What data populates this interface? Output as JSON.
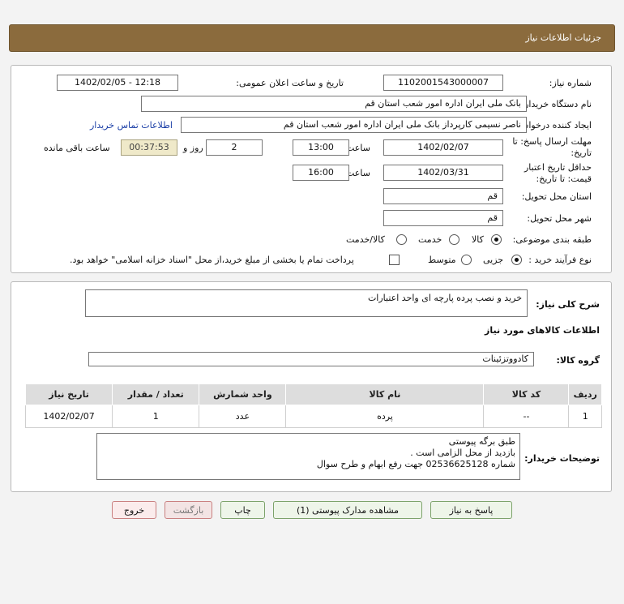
{
  "header": {
    "title": "جزئیات اطلاعات نیاز"
  },
  "form": {
    "need_number_label": "شماره نیاز:",
    "need_number": "1102001543000007",
    "announce_label": "تاریخ و ساعت اعلان عمومی:",
    "announce_value": "1402/02/05 - 12:18",
    "buyer_org_label": "نام دستگاه خریدار:",
    "buyer_org": "بانک ملی ایران اداره امور شعب استان قم",
    "creator_label": "ایجاد کننده درخواست:",
    "creator": "ناصر  نسیمی  کارپرداز  بانک ملی ایران اداره امور شعب استان قم",
    "contact_link": "اطلاعات تماس خریدار",
    "deadline_label_1": "مهلت ارسال پاسخ: تا",
    "deadline_label_2": "تاریخ:",
    "deadline_date": "1402/02/07",
    "time_label": "ساعت",
    "deadline_time": "13:00",
    "days": "2",
    "days_label": "روز و",
    "remaining_time": "00:37:53",
    "remaining_label": "ساعت باقی مانده",
    "validity_label_1": "حداقل تاریخ اعتبار",
    "validity_label_2": "قیمت: تا تاریخ:",
    "validity_date": "1402/03/31",
    "validity_time": "16:00",
    "province_label": "استان محل تحویل:",
    "province": "قم",
    "city_label": "شهر محل تحویل:",
    "city": "قم",
    "category_label": "طبقه بندی موضوعی:",
    "category_options": [
      "کالا",
      "خدمت",
      "کالا/خدمت"
    ],
    "process_label": "نوع فرآیند خرید :",
    "process_options": [
      "جزیی",
      "متوسط"
    ],
    "payment_note": "پرداخت تمام یا بخشی از مبلغ خرید،از محل \"اسناد خزانه اسلامی\" خواهد بود."
  },
  "details": {
    "summary_label": "شرح کلی نیاز:",
    "summary": "خرید و نصب پرده پارچه ای واحد اعتبارات",
    "goods_section_title": "اطلاعات کالاهای مورد نیاز",
    "goods_group_label": "گروه کالا:",
    "goods_group": "کادووتزئینات",
    "table": {
      "headers": [
        "ردیف",
        "کد کالا",
        "نام کالا",
        "واحد شمارش",
        "تعداد / مقدار",
        "تاریخ نیاز"
      ],
      "rows": [
        [
          "1",
          "--",
          "پرده",
          "عدد",
          "1",
          "1402/02/07"
        ]
      ]
    },
    "buyer_notes_label": "توضیحات خریدار:",
    "buyer_notes": "طبق برگه پیوستی\nبازدید از محل الزامی است .\nشماره 02536625128 جهت رفع ابهام و طرح سوال"
  },
  "buttons": {
    "reply": "پاسخ به نیاز",
    "attachments": "مشاهده مدارک پیوستی (1)",
    "print": "چاپ",
    "back": "بازگشت",
    "exit": "خروج"
  }
}
